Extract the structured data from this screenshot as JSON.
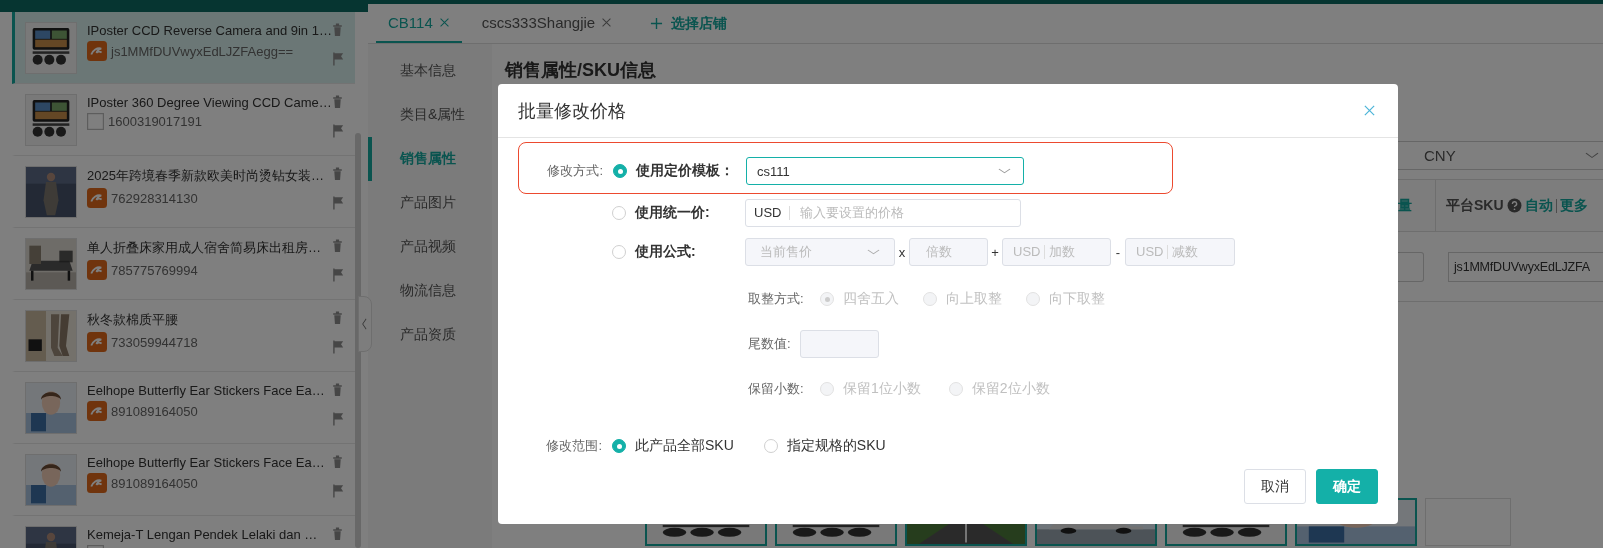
{
  "products": [
    {
      "title": "IPoster CCD Reverse Camera and 9in 1…",
      "id": "js1MMfDUVwyxEdLJZFAegg==",
      "kind": "logo",
      "selected": true
    },
    {
      "title": "IPoster 360 Degree Viewing CCD Came…",
      "id": "1600319017191",
      "kind": "blank",
      "selected": false
    },
    {
      "title": "2025年跨境春季新款欧美时尚烫钻女装…",
      "id": "762928314130",
      "kind": "logo",
      "selected": false
    },
    {
      "title": "单人折叠床家用成人宿舍简易床出租房…",
      "id": "785775769994",
      "kind": "logo",
      "selected": false
    },
    {
      "title": "秋冬款棉质平腰",
      "id": "733059944718",
      "kind": "logo",
      "selected": false
    },
    {
      "title": "Eelhope Butterfly Ear Stickers Face Ea…",
      "id": "891089164050",
      "kind": "logo",
      "selected": false
    },
    {
      "title": "Eelhope Butterfly Ear Stickers Face Ea…",
      "id": "891089164050",
      "kind": "logo",
      "selected": false
    },
    {
      "title": "Kemeja-T Lengan Pendek Lelaki dan …",
      "kind": "blank",
      "selected": false
    }
  ],
  "store_tabs": [
    {
      "label": "CB114",
      "selected": true
    },
    {
      "label": "cscs333Shangjie",
      "selected": false
    }
  ],
  "add_store": "选择店铺",
  "nav": [
    {
      "label": "基本信息",
      "selected": false
    },
    {
      "label": "类目&属性",
      "selected": false
    },
    {
      "label": "销售属性",
      "selected": true
    },
    {
      "label": "产品图片",
      "selected": false
    },
    {
      "label": "产品视频",
      "selected": false
    },
    {
      "label": "物流信息",
      "selected": false
    },
    {
      "label": "产品资质",
      "selected": false
    }
  ],
  "section_title": "销售属性/SKU信息",
  "currency": "CNY",
  "table": {
    "column_1": "量",
    "column_2": "平台SKU",
    "column_2_links": [
      "自动",
      "更多"
    ],
    "row_value": "js1MMfDUVwyxEdLJZFA"
  },
  "gallery": [
    {
      "kind": "picture"
    },
    {
      "kind": "picture"
    },
    {
      "kind": "picture"
    },
    {
      "kind": "picture"
    },
    {
      "kind": "picture"
    },
    {
      "kind": "picture"
    },
    {
      "kind": "empty"
    }
  ],
  "dialog": {
    "title": "批量修改价格",
    "method": {
      "label": "修改方式:",
      "highlighted": true,
      "options": [
        {
          "kind": "template",
          "label": "使用定价模板：",
          "selected": true,
          "value": "cs111"
        },
        {
          "kind": "fixed",
          "label": "使用统一价:",
          "selected": false,
          "currency": "USD",
          "placeholder": "输入要设置的价格"
        },
        {
          "kind": "formula",
          "label": "使用公式:",
          "selected": false,
          "base": "当前售价",
          "times": "x",
          "multiplier_placeholder": "倍数",
          "plus": "+",
          "add_currency": "USD",
          "add_placeholder": "加数",
          "minus": "-",
          "sub_currency": "USD",
          "sub_placeholder": "减数"
        }
      ]
    },
    "rounding": {
      "label": "取整方式:",
      "options": [
        {
          "label": "四舍五入",
          "selected": true
        },
        {
          "label": "向上取整",
          "selected": false
        },
        {
          "label": "向下取整",
          "selected": false
        }
      ]
    },
    "tail": {
      "label": "尾数值:"
    },
    "decimals": {
      "label": "保留小数:",
      "options": [
        {
          "label": "保留1位小数",
          "selected": false
        },
        {
          "label": "保留2位小数",
          "selected": false
        }
      ]
    },
    "scope": {
      "label": "修改范围:",
      "options": [
        {
          "label": "此产品全部SKU",
          "selected": true
        },
        {
          "label": "指定规格的SKU",
          "selected": false
        }
      ]
    },
    "buttons": [
      {
        "label": "取消",
        "kind": "secondary"
      },
      {
        "label": "确定",
        "kind": "primary"
      }
    ]
  }
}
